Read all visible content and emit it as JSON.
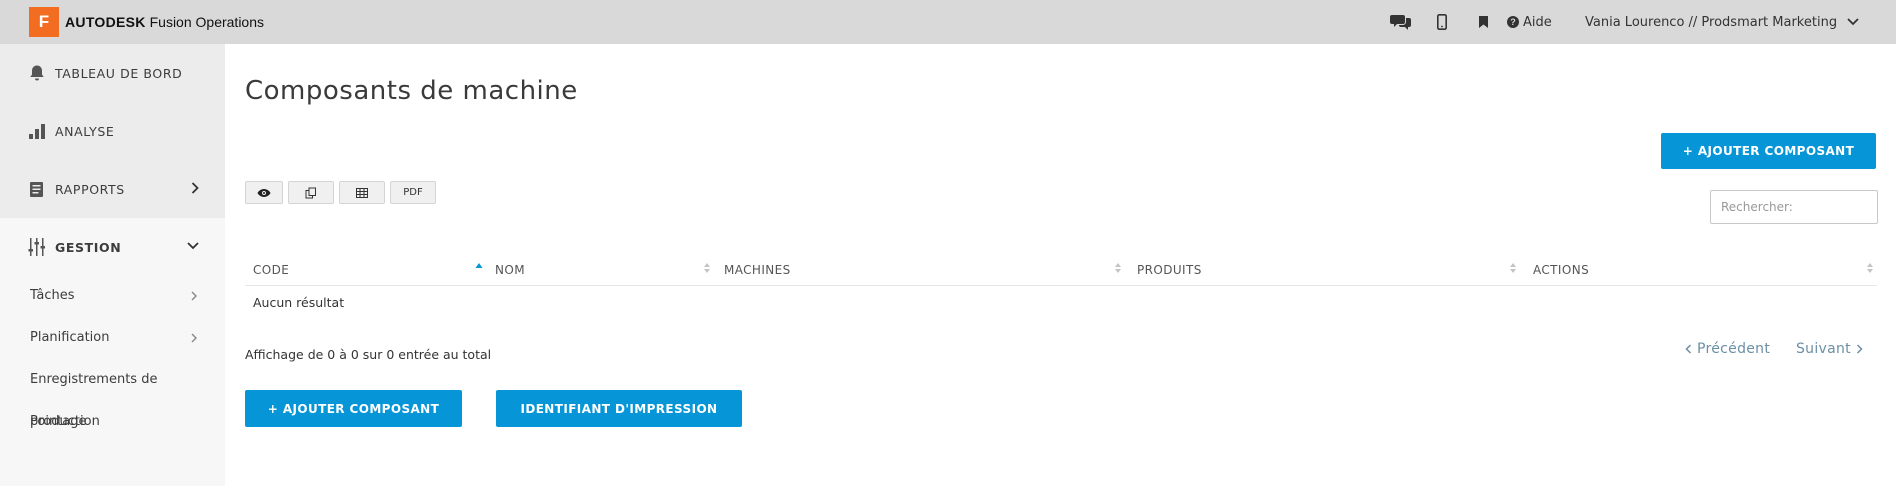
{
  "app": {
    "logo_letter": "F",
    "brand": "AUTODESK",
    "product": "Fusion Operations",
    "accent_color": "#0696d7",
    "logo_color": "#f26c21"
  },
  "topbar": {
    "icons": [
      "chat-icon",
      "mobile-icon",
      "bookmark-icon"
    ],
    "help_label": "Aide",
    "user_label": "Vania Lourenco // Prodsmart Marketing"
  },
  "sidebar": {
    "items": [
      {
        "label": "TABLEAU DE BORD",
        "icon": "bell-icon"
      },
      {
        "label": "ANALYSE",
        "icon": "bar-chart-icon"
      },
      {
        "label": "RAPPORTS",
        "icon": "report-icon"
      },
      {
        "label": "GESTION",
        "icon": "sliders-icon"
      }
    ],
    "subitems": [
      {
        "label": "Tâches"
      },
      {
        "label": "Planification"
      },
      {
        "label": "Enregistrements de"
      },
      {
        "label": "production"
      },
      {
        "label": "Pointage"
      }
    ]
  },
  "main": {
    "title": "Composants de machine",
    "add_button_label": "+ AJOUTER COMPOSANT",
    "export_buttons": [
      "eye-icon",
      "copy-icon",
      "table-icon",
      "PDF"
    ],
    "search_placeholder": "Rechercher:",
    "table": {
      "columns": [
        "CODE",
        "NOM",
        "MACHINES",
        "PRODUITS",
        "ACTIONS"
      ],
      "empty_text": "Aucun résultat"
    },
    "info_text": "Affichage de 0 à 0 sur 0 entrée au total",
    "pager": {
      "prev": "Précédent",
      "next": "Suivant"
    },
    "bottom_buttons": {
      "add": "+ AJOUTER COMPOSANT",
      "print": "IDENTIFIANT D'IMPRESSION"
    }
  }
}
